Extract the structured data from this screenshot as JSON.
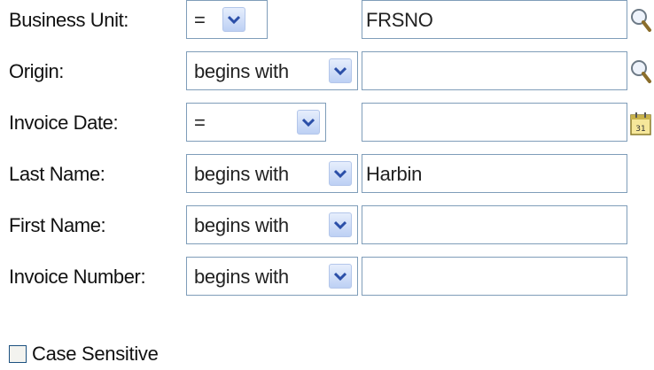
{
  "fields": [
    {
      "label": "Business Unit:",
      "operator": "=",
      "value": "FRSNO",
      "action_icon": "lookup-magnifier-icon"
    },
    {
      "label": "Origin:",
      "operator": "begins with",
      "value": "",
      "action_icon": "lookup-magnifier-icon"
    },
    {
      "label": "Invoice Date:",
      "operator": "=",
      "value": "",
      "action_icon": "calendar-icon"
    },
    {
      "label": "Last Name:",
      "operator": "begins with",
      "value": "Harbin",
      "action_icon": ""
    },
    {
      "label": "First Name:",
      "operator": "begins with",
      "value": "",
      "action_icon": ""
    },
    {
      "label": "Invoice Number:",
      "operator": "begins with",
      "value": "",
      "action_icon": ""
    }
  ],
  "case_sensitive": {
    "label": "Case Sensitive",
    "checked": false
  },
  "icons": {
    "dropdown": "chevron-down-icon"
  },
  "colors": {
    "border": "#7f9db9",
    "dropdown_button": "#bdd0f4",
    "chevron": "#2b4fa8"
  }
}
